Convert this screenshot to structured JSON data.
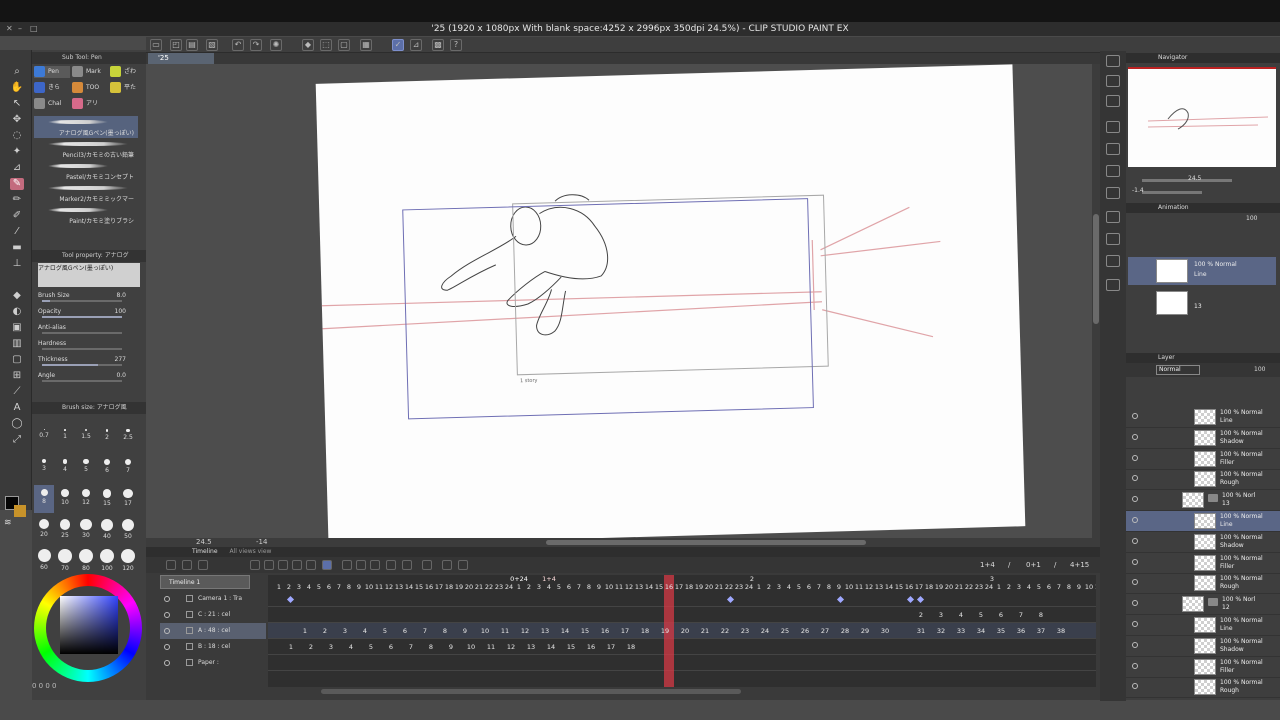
{
  "window": {
    "title": "'25 (1920 x 1080px With blank space:4252 x 2996px 350dpi 24.5%) - CLIP STUDIO PAINT EX"
  },
  "canvas_tab": {
    "label": "'25"
  },
  "subtool": {
    "header": "Sub Tool: Pen",
    "tabs": [
      {
        "label": "Pen",
        "color": "#3d7ad6"
      },
      {
        "label": "Mark",
        "color": "#8a8a8a"
      },
      {
        "label": "ざわ",
        "color": "#c7d43a"
      },
      {
        "label": "きら",
        "color": "#3d66c8"
      },
      {
        "label": "TOO",
        "color": "#d68a3a"
      },
      {
        "label": "平た",
        "color": "#d6c23a"
      },
      {
        "label": "Chal",
        "color": "#8a8a8a"
      },
      {
        "label": "アリ",
        "color": "#d66a8a"
      }
    ],
    "brushes": [
      "アナログ風Gペン(墨っぽい)",
      "Pencil3/カモミの古い鉛筆",
      "Pastel/カモミコンセプト",
      "Marker2/カモミミックマー",
      "Paint/カモミ塗りブラシ"
    ]
  },
  "tool_property": {
    "header": "Tool property: アナログ",
    "brush_name": "アナログ風Gペン(墨っぽい)",
    "rows": [
      {
        "label": "Brush Size",
        "value": "8.0",
        "fill": 0.1
      },
      {
        "label": "Opacity",
        "value": "100",
        "fill": 1.0
      },
      {
        "label": "Anti-alias",
        "value": "",
        "fill": 0
      },
      {
        "label": "Hardness",
        "value": "",
        "fill": 0
      },
      {
        "label": "Thickness",
        "value": "277",
        "fill": 0.7
      },
      {
        "label": "Angle",
        "value": "0.0",
        "fill": 0
      }
    ]
  },
  "brush_size": {
    "header": "Brush size: アナログ風",
    "sizes": [
      "0.7",
      "1",
      "1.5",
      "2",
      "2.5",
      "3",
      "4",
      "5",
      "6",
      "7",
      "8",
      "10",
      "12",
      "15",
      "17",
      "20",
      "25",
      "30",
      "40",
      "50",
      "60",
      "70",
      "80",
      "100",
      "120"
    ],
    "selected": "8"
  },
  "color_footer": "0  0  0  0",
  "status": {
    "zoom": "24.5",
    "angle": "-14"
  },
  "timeline": {
    "header": "Timeline",
    "header_hint": "All views view",
    "name": "Timeline 1",
    "marker_a": "0+24",
    "marker_b": "1+4",
    "marker_c": "2",
    "marker_d": "3",
    "right_fields": [
      "1+4",
      "/",
      "0+1",
      "/",
      "4+15"
    ],
    "ruler": [
      "1",
      "2",
      "3",
      "4",
      "5",
      "6",
      "7",
      "8",
      "9",
      "10",
      "11",
      "12",
      "13",
      "14",
      "15",
      "16",
      "17",
      "18",
      "19",
      "20",
      "21",
      "22",
      "23",
      "24",
      "1",
      "2",
      "3",
      "4",
      "5",
      "6",
      "7",
      "8",
      "9",
      "10",
      "11",
      "12",
      "13",
      "14",
      "15",
      "16",
      "17",
      "18",
      "19",
      "20",
      "21",
      "22",
      "23",
      "24",
      "1",
      "2",
      "3",
      "4",
      "5",
      "6",
      "7",
      "8",
      "9",
      "10",
      "11",
      "12",
      "13",
      "14",
      "15",
      "16",
      "17",
      "18",
      "19",
      "20",
      "21",
      "22",
      "23",
      "24",
      "1",
      "2",
      "3",
      "4",
      "5",
      "6",
      "7",
      "8",
      "9",
      "10",
      "11"
    ],
    "tracks": [
      {
        "name": "Camera 1 : Tra",
        "selected": false
      },
      {
        "name": "C : 21 : cel",
        "selected": false
      },
      {
        "name": "A : 48 : cel",
        "selected": true
      },
      {
        "name": "B : 18 : cel",
        "selected": false
      },
      {
        "name": "Paper :",
        "selected": false
      }
    ],
    "row_c": [
      "2",
      "3",
      "4",
      "5",
      "6",
      "7",
      "8"
    ],
    "row_a": [
      "1",
      "2",
      "3",
      "4",
      "5",
      "6",
      "7",
      "8",
      "9",
      "10",
      "11",
      "12",
      "13",
      "14",
      "15",
      "16",
      "17",
      "18",
      "19",
      "20",
      "21",
      "22",
      "23",
      "24",
      "25",
      "26",
      "27",
      "28",
      "29",
      "30",
      "31",
      "32",
      "33",
      "34",
      "35",
      "36",
      "37",
      "38"
    ],
    "row_b": [
      "1",
      "2",
      "3",
      "4",
      "5",
      "6",
      "7",
      "8",
      "9",
      "10",
      "11",
      "12",
      "13",
      "14",
      "15",
      "16",
      "17",
      "18"
    ]
  },
  "navigator": {
    "header": "Navigator",
    "zoom": "24.5",
    "angle": "-1.4"
  },
  "animation": {
    "header": "Animation",
    "opacity": "100",
    "cels": [
      {
        "line1": "100 % Normal",
        "line2": "Line",
        "selected": true
      },
      {
        "line1": "",
        "line2": "13",
        "selected": false
      }
    ]
  },
  "layer": {
    "header": "Layer",
    "blend": "Normal",
    "opacity": "100",
    "rows": [
      {
        "line1": "100 % Normal",
        "line2": "Line",
        "indent": 1,
        "type": "layer",
        "selected": false
      },
      {
        "line1": "100 % Normal",
        "line2": "Shadow",
        "indent": 1,
        "type": "layer",
        "selected": false
      },
      {
        "line1": "100 % Normal",
        "line2": "Filler",
        "indent": 1,
        "type": "layer",
        "selected": false
      },
      {
        "line1": "100 % Normal",
        "line2": "Rough",
        "indent": 1,
        "type": "layer",
        "selected": false
      },
      {
        "line1": "100 % Norl",
        "line2": "13",
        "indent": 0,
        "type": "folder",
        "selected": false
      },
      {
        "line1": "100 % Normal",
        "line2": "Line",
        "indent": 1,
        "type": "layer",
        "selected": true
      },
      {
        "line1": "100 % Normal",
        "line2": "Shadow",
        "indent": 1,
        "type": "layer",
        "selected": false
      },
      {
        "line1": "100 % Normal",
        "line2": "Filler",
        "indent": 1,
        "type": "layer",
        "selected": false
      },
      {
        "line1": "100 % Normal",
        "line2": "Rough",
        "indent": 1,
        "type": "layer",
        "selected": false
      },
      {
        "line1": "100 % Norl",
        "line2": "12",
        "indent": 0,
        "type": "folder",
        "selected": false
      },
      {
        "line1": "100 % Normal",
        "line2": "Line",
        "indent": 1,
        "type": "layer",
        "selected": false
      },
      {
        "line1": "100 % Normal",
        "line2": "Shadow",
        "indent": 1,
        "type": "layer",
        "selected": false
      },
      {
        "line1": "100 % Normal",
        "line2": "Filler",
        "indent": 1,
        "type": "layer",
        "selected": false
      },
      {
        "line1": "100 % Normal",
        "line2": "Rough",
        "indent": 1,
        "type": "layer",
        "selected": false
      }
    ]
  },
  "drawing_caption": "1 story",
  "icons": {
    "close": "close-icon",
    "pen_tool": "pen-icon",
    "eye": "eye-icon",
    "play": "play-icon",
    "folder": "folder-icon"
  },
  "colors": {
    "selection": "#5a6686",
    "playhead": "#d63a46",
    "camera_frame": "#6e6eb4",
    "perspective": "#e0a4a8"
  }
}
